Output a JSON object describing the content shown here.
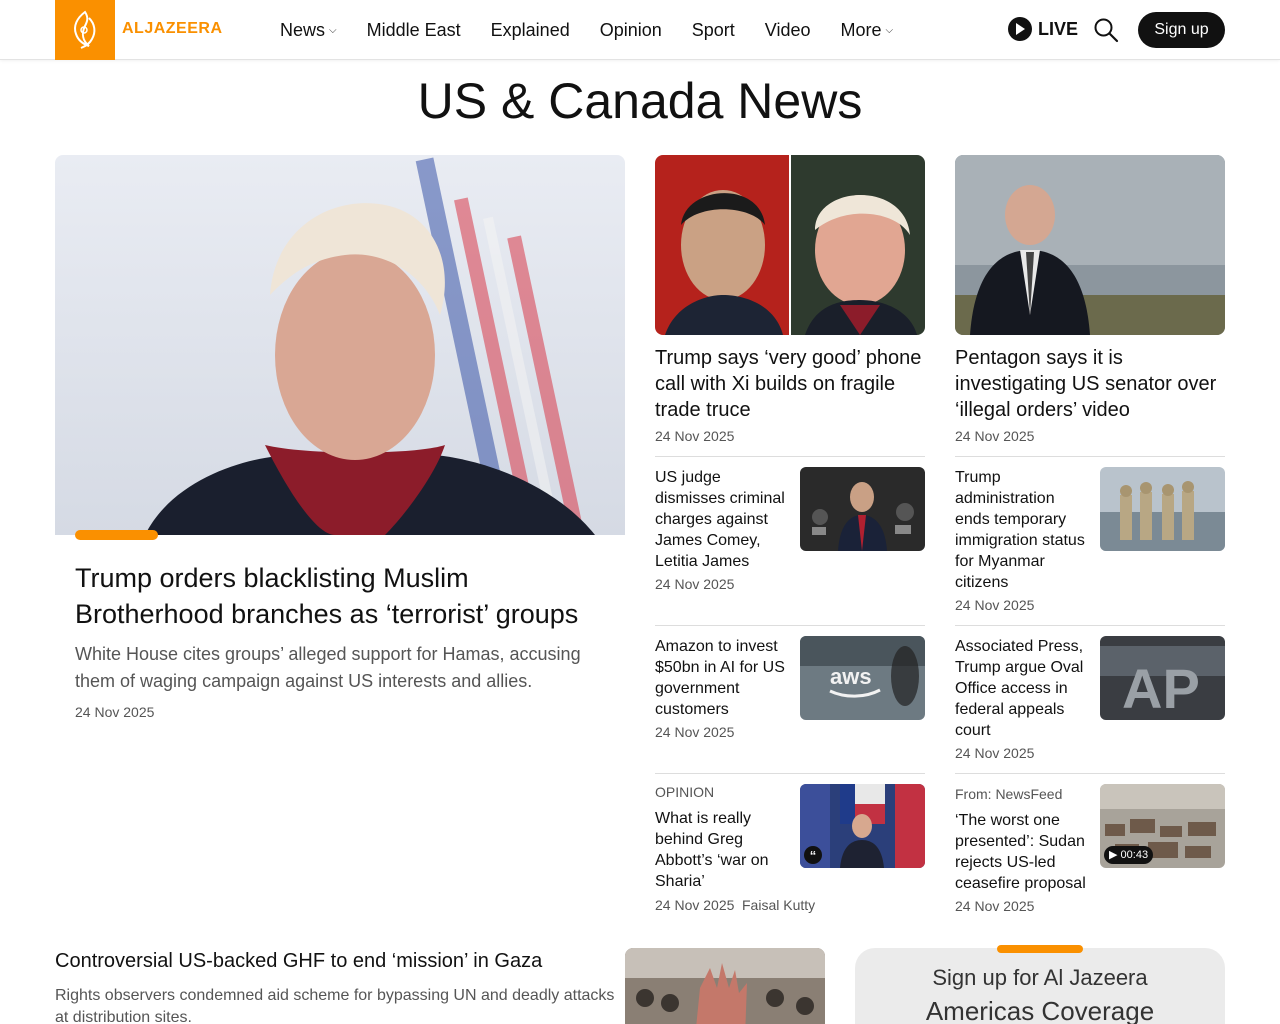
{
  "brand": {
    "name": "ALJAZEERA",
    "color": "#fa9000"
  },
  "nav": {
    "items": [
      {
        "label": "News",
        "dropdown": true
      },
      {
        "label": "Middle East",
        "dropdown": false
      },
      {
        "label": "Explained",
        "dropdown": false
      },
      {
        "label": "Opinion",
        "dropdown": false
      },
      {
        "label": "Sport",
        "dropdown": false
      },
      {
        "label": "Video",
        "dropdown": false
      },
      {
        "label": "More",
        "dropdown": true
      }
    ],
    "live_label": "LIVE",
    "signup_label": "Sign up"
  },
  "page_title": "US & Canada News",
  "hero": {
    "title": "Trump orders blacklisting Muslim Brotherhood branches as ‘terrorist’ groups",
    "subtitle": "White House cites groups’ alleged support for Hamas, accusing them of waging campaign against US interests and allies.",
    "date": "24 Nov 2025"
  },
  "col1": {
    "main": {
      "title": "Trump says ‘very good’ phone call with Xi builds on fragile trade truce",
      "date": "24 Nov 2025"
    },
    "items": [
      {
        "title": "US judge dismisses criminal charges against James Comey, Letitia James",
        "date": "24 Nov 2025"
      },
      {
        "title": "Amazon to invest $50bn in AI for US government customers",
        "date": "24 Nov 2025"
      },
      {
        "kicker": "OPINION",
        "title": "What is really behind Greg Abbott’s ‘war on Sharia’",
        "date": "24 Nov 2025",
        "author": "Faisal Kutty"
      }
    ]
  },
  "col2": {
    "main": {
      "title": "Pentagon says it is investigating US senator over ‘illegal orders’ video",
      "date": "24 Nov 2025"
    },
    "items": [
      {
        "title": "Trump administration ends temporary immigration status for Myanmar citizens",
        "date": "24 Nov 2025"
      },
      {
        "title": "Associated Press, Trump argue Oval Office access in federal appeals court",
        "date": "24 Nov 2025"
      },
      {
        "kicker": "From: NewsFeed",
        "title": "‘The worst one presented’: Sudan rejects US-led ceasefire proposal",
        "date": "24 Nov 2025",
        "video_duration": "00:43"
      }
    ]
  },
  "bottom": {
    "title": "Controversial US-backed GHF to end ‘mission’ in Gaza",
    "subtitle": "Rights observers condemned aid scheme for bypassing UN and deadly attacks at distribution sites."
  },
  "signup": {
    "line1": "Sign up for Al Jazeera",
    "line2": "Americas Coverage"
  }
}
